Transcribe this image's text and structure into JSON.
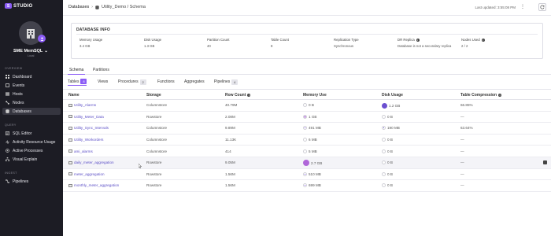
{
  "app": {
    "logo_mark": "S",
    "logo_text": "STUDIO"
  },
  "org": {
    "name": "SME MemSQL",
    "sub": "Local"
  },
  "sidebar": {
    "overview_label": "OVERVIEW",
    "overview": [
      {
        "label": "Dashboard",
        "icon": "dashboard-icon"
      },
      {
        "label": "Events",
        "icon": "events-icon"
      },
      {
        "label": "Hosts",
        "icon": "hosts-icon"
      },
      {
        "label": "Nodes",
        "icon": "nodes-icon"
      },
      {
        "label": "Databases",
        "icon": "database-icon"
      }
    ],
    "query_label": "QUERY",
    "query": [
      {
        "label": "SQL Editor",
        "icon": "sql-editor-icon"
      },
      {
        "label": "Activity Resource Usage",
        "icon": "activity-icon"
      },
      {
        "label": "Active Processes",
        "icon": "processes-icon"
      },
      {
        "label": "Visual Explain",
        "icon": "explain-icon"
      }
    ],
    "ingest_label": "INGEST",
    "ingest": [
      {
        "label": "Pipelines",
        "icon": "pipelines-icon"
      }
    ]
  },
  "header": {
    "crumb_root": "Databases",
    "crumb_current": "Utility_Demo / Schema",
    "last_updated": "Last updated: 3:55:08 PM"
  },
  "db_info": {
    "title": "DATABASE INFO",
    "metrics": [
      {
        "label": "Memory Usage",
        "value": "3.4 GB"
      },
      {
        "label": "Disk Usage",
        "value": "1.3 GB"
      },
      {
        "label": "Partition Count",
        "value": "40"
      },
      {
        "label": "Table Count",
        "value": "8"
      },
      {
        "label": "Replication Type",
        "value": "Synchronous"
      },
      {
        "label": "DR Replica",
        "value": "Database is not a secondary replica"
      },
      {
        "label": "Nodes Used",
        "value": "2 / 2"
      }
    ]
  },
  "main_tabs": [
    "Schema",
    "Partitions"
  ],
  "sub_tabs": [
    {
      "label": "Tables",
      "count": "8"
    },
    {
      "label": "Views",
      "count": ""
    },
    {
      "label": "Procedures",
      "count": "2"
    },
    {
      "label": "Functions",
      "count": ""
    },
    {
      "label": "Aggregates",
      "count": ""
    },
    {
      "label": "Pipelines",
      "count": "4"
    }
  ],
  "table": {
    "headers": [
      "Name",
      "Storage",
      "Row Count",
      "Memory Use",
      "Disk Usage",
      "Table Compression"
    ],
    "rows": [
      {
        "name": "Utility_Alarms",
        "storage": "Columnstore",
        "rows": "40.79M",
        "mem": "0 B",
        "disk": "1.2 GB",
        "comp": "66.85%"
      },
      {
        "name": "Utility_Meter_Data",
        "storage": "Rowstore",
        "rows": "2.08M",
        "mem": "1 GB",
        "disk": "0 B",
        "comp": "—"
      },
      {
        "name": "Utility_Sync_Intervals",
        "storage": "Columnstore",
        "rows": "9.89M",
        "mem": "491 MB",
        "disk": "190 MB",
        "comp": "63.64%"
      },
      {
        "name": "Utility_Workorders",
        "storage": "Columnstore",
        "rows": "11.13K",
        "mem": "6 MB",
        "disk": "0 B",
        "comp": "—"
      },
      {
        "name": "ami_alarms",
        "storage": "Columnstore",
        "rows": "414",
        "mem": "5 MB",
        "disk": "0 B",
        "comp": "—"
      },
      {
        "name": "daily_meter_aggregation",
        "storage": "Rowstore",
        "rows": "9.05M",
        "mem": "2.7 GB",
        "disk": "0 B",
        "comp": "—"
      },
      {
        "name": "meter_aggregation",
        "storage": "Rowstore",
        "rows": "1.56M",
        "mem": "510 MB",
        "disk": "0 B",
        "comp": "—"
      },
      {
        "name": "monthly_meter_aggregation",
        "storage": "Rowstore",
        "rows": "1.56M",
        "mem": "699 MB",
        "disk": "0 B",
        "comp": "—"
      }
    ]
  },
  "colors": {
    "accent": "#8b5cf6",
    "sidebar_bg": "#1c1c24"
  }
}
